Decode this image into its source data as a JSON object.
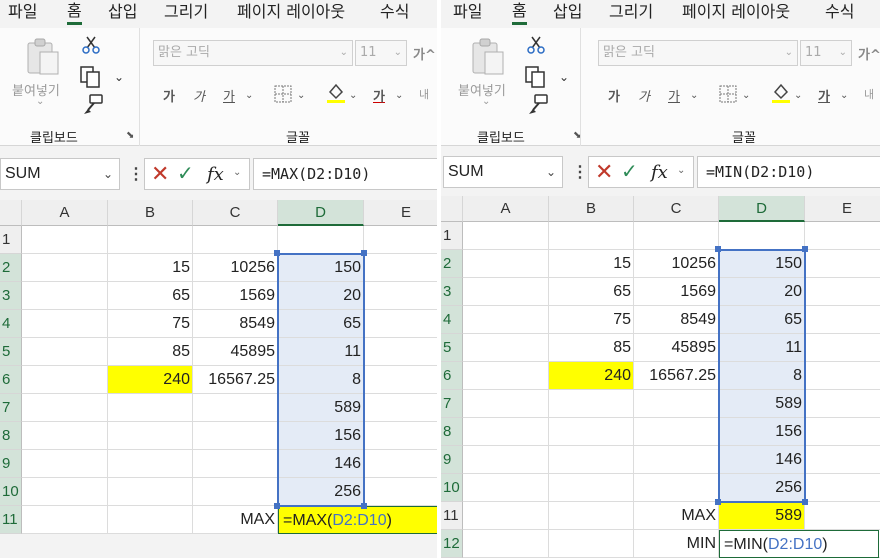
{
  "menu": [
    "파일",
    "홈",
    "삽입",
    "그리기",
    "페이지 레이아웃",
    "수식"
  ],
  "active_tab": "홈",
  "ribbon": {
    "paste_label": "붙여넣기",
    "clipboard_label": "클립보드",
    "font_label": "글꼴",
    "font_name": "맑은 고딕",
    "font_size": "11",
    "grow_font": "가^",
    "bold": "가",
    "italic": "가",
    "underline": "가",
    "font_color": "가",
    "more": "내"
  },
  "columns": [
    "A",
    "B",
    "C",
    "D",
    "E"
  ],
  "left": {
    "name_box": "SUM",
    "formula": "=MAX(D2:D10)",
    "rows": [
      "1",
      "2",
      "3",
      "4",
      "5",
      "6",
      "7",
      "8",
      "9",
      "10",
      "11"
    ],
    "col_b": [
      "",
      "15",
      "65",
      "75",
      "85",
      "240",
      "",
      "",
      "",
      "",
      ""
    ],
    "col_c": [
      "",
      "10256",
      "1569",
      "8549",
      "45895",
      "16567.25",
      "",
      "",
      "",
      "",
      "MAX"
    ],
    "col_d": [
      "",
      "150",
      "20",
      "65",
      "11",
      "8",
      "589",
      "156",
      "146",
      "256",
      ""
    ],
    "edit": {
      "prefix": "=MAX(",
      "ref": "D2:D10",
      "suffix": ")"
    }
  },
  "right": {
    "name_box": "SUM",
    "formula": "=MIN(D2:D10)",
    "rows": [
      "1",
      "2",
      "3",
      "4",
      "5",
      "6",
      "7",
      "8",
      "9",
      "10",
      "11",
      "12"
    ],
    "col_b": [
      "",
      "15",
      "65",
      "75",
      "85",
      "240",
      "",
      "",
      "",
      "",
      "",
      ""
    ],
    "col_c": [
      "",
      "10256",
      "1569",
      "8549",
      "45895",
      "16567.25",
      "",
      "",
      "",
      "",
      "MAX",
      "MIN"
    ],
    "col_d": [
      "",
      "150",
      "20",
      "65",
      "11",
      "8",
      "589",
      "156",
      "146",
      "256",
      "589",
      ""
    ],
    "edit": {
      "prefix": "=MIN(",
      "ref": "D2:D10",
      "suffix": ")"
    }
  }
}
